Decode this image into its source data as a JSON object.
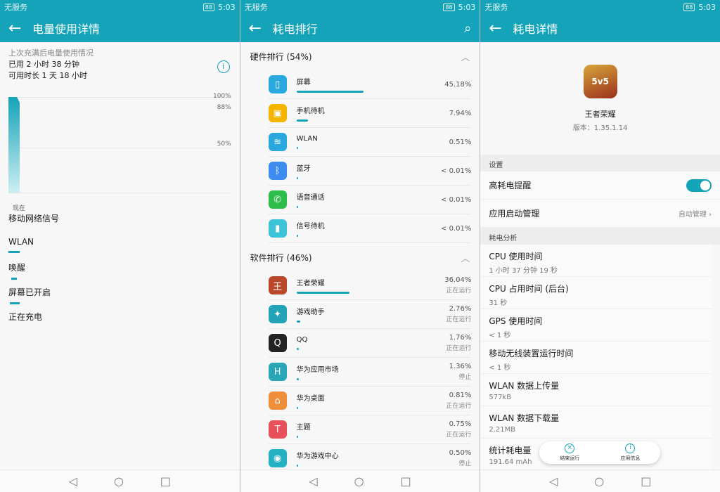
{
  "status": {
    "carrier": "无服务",
    "battery": "88",
    "time": "5:03"
  },
  "s1": {
    "title": "电量使用详情",
    "summary_title": "上次充满后电量使用情况",
    "used": "已用 2 小时 38 分钟",
    "remaining": "可用时长 1 天 18 小时",
    "levels": [
      "100%",
      "88%",
      "50%"
    ],
    "now_label": "现在",
    "items": [
      {
        "label": "移动网络信号",
        "bar": false
      },
      {
        "label": "WLAN",
        "bar": true
      },
      {
        "label": "唤醒",
        "bar": true
      },
      {
        "label": "屏幕已开启",
        "bar": true
      },
      {
        "label": "正在充电",
        "bar": false
      }
    ]
  },
  "s2": {
    "title": "耗电排行",
    "hardware_head": "硬件排行 (54%)",
    "software_head": "软件排行 (46%)",
    "hardware": [
      {
        "name": "屏幕",
        "value": "45.18%",
        "pct": 45.18,
        "color": "#2aa9e0",
        "icon": "screen-icon",
        "glyph": "▯"
      },
      {
        "name": "手机待机",
        "value": "7.94%",
        "pct": 7.94,
        "color": "#f4b400",
        "icon": "standby-icon",
        "glyph": "▣"
      },
      {
        "name": "WLAN",
        "value": "0.51%",
        "pct": 0.51,
        "color": "#29a8e0",
        "icon": "wifi-icon",
        "glyph": "≋"
      },
      {
        "name": "蓝牙",
        "value": "< 0.01%",
        "pct": 0.01,
        "color": "#3f8cf0",
        "icon": "bluetooth-icon",
        "glyph": "ᛒ"
      },
      {
        "name": "语音通话",
        "value": "< 0.01%",
        "pct": 0.01,
        "color": "#2ebd4a",
        "icon": "phone-icon",
        "glyph": "✆"
      },
      {
        "name": "信号待机",
        "value": "< 0.01%",
        "pct": 0.01,
        "color": "#3cc3d8",
        "icon": "signal-icon",
        "glyph": "▮"
      }
    ],
    "software": [
      {
        "name": "王者荣耀",
        "value": "36.04%",
        "pct": 36.04,
        "status": "正在运行",
        "color": "#b9472a",
        "icon": "game-app-icon",
        "glyph": "王"
      },
      {
        "name": "游戏助手",
        "value": "2.76%",
        "pct": 2.76,
        "status": "正在运行",
        "color": "#22a3b8",
        "icon": "game-assistant-icon",
        "glyph": "✦"
      },
      {
        "name": "QQ",
        "value": "1.76%",
        "pct": 1.76,
        "status": "正在运行",
        "color": "#222",
        "icon": "qq-icon",
        "glyph": "Q"
      },
      {
        "name": "华为应用市场",
        "value": "1.36%",
        "pct": 1.36,
        "status": "停止",
        "color": "#2aa7b6",
        "icon": "app-market-icon",
        "glyph": "H"
      },
      {
        "name": "华为桌面",
        "value": "0.81%",
        "pct": 0.81,
        "status": "正在运行",
        "color": "#f08f3b",
        "icon": "home-icon",
        "glyph": "⌂"
      },
      {
        "name": "主题",
        "value": "0.75%",
        "pct": 0.75,
        "status": "正在运行",
        "color": "#e8505b",
        "icon": "theme-icon",
        "glyph": "T"
      },
      {
        "name": "华为游戏中心",
        "value": "0.50%",
        "pct": 0.5,
        "status": "停止",
        "color": "#25b1c4",
        "icon": "game-center-icon",
        "glyph": "◉"
      }
    ]
  },
  "s3": {
    "title": "耗电详情",
    "app_name": "王者荣耀",
    "version": "版本：1.35.1.14",
    "settings_head": "设置",
    "high_power_alert": "高耗电提醒",
    "launch_mgmt": "应用启动管理",
    "launch_mgmt_value": "自动管理",
    "analysis_head": "耗电分析",
    "stats": [
      {
        "label": "CPU 使用时间",
        "value": "1 小时 37 分钟 19 秒"
      },
      {
        "label": "CPU 占用时间 (后台)",
        "value": "31 秒"
      },
      {
        "label": "GPS 使用时间",
        "value": "< 1 秒"
      },
      {
        "label": "移动无线装置运行时间",
        "value": "< 1 秒"
      },
      {
        "label": "WLAN 数据上传量",
        "value": "577kB"
      },
      {
        "label": "WLAN 数据下载量",
        "value": "2.21MB"
      },
      {
        "label": "统计耗电量",
        "value": "191.64 mAh"
      }
    ],
    "end_run": "结束运行",
    "app_info": "应用信息"
  }
}
